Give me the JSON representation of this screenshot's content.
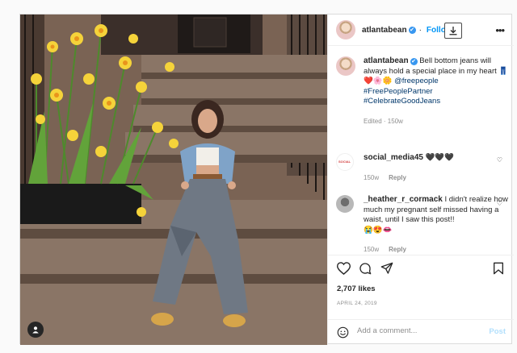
{
  "post": {
    "author": "atlantabean",
    "follow_label": "Follow",
    "caption": {
      "author": "atlantabean",
      "text": "Bell bottom jeans will always hold a special place in my heart",
      "emojis": "👖❤️🌸🌼",
      "mention": "@freepeople",
      "hashtags": [
        "#FreePeoplePartner",
        "#CelebrateGoodJeans"
      ],
      "edited": "Edited · 150w"
    },
    "comments": [
      {
        "user": "social_media45",
        "text": "🖤🖤🖤",
        "time": "150w",
        "reply": "Reply"
      },
      {
        "user": "_heather_r_cormack",
        "text": "I didn't realize how much my pregnant self missed having a waist, until I saw this post!!",
        "emojis": "😭😍👄",
        "time": "150w",
        "reply": "Reply"
      }
    ],
    "likes": "2,707 likes",
    "date": "APRIL 24, 2019",
    "comment_placeholder": "Add a comment...",
    "post_label": "Post"
  },
  "icons": {
    "verified": "✔",
    "more": "•••"
  },
  "colors": {
    "link": "#00376b",
    "accent": "#0095f6",
    "post_disabled": "#b2dffc",
    "verified": "#3897f0"
  }
}
